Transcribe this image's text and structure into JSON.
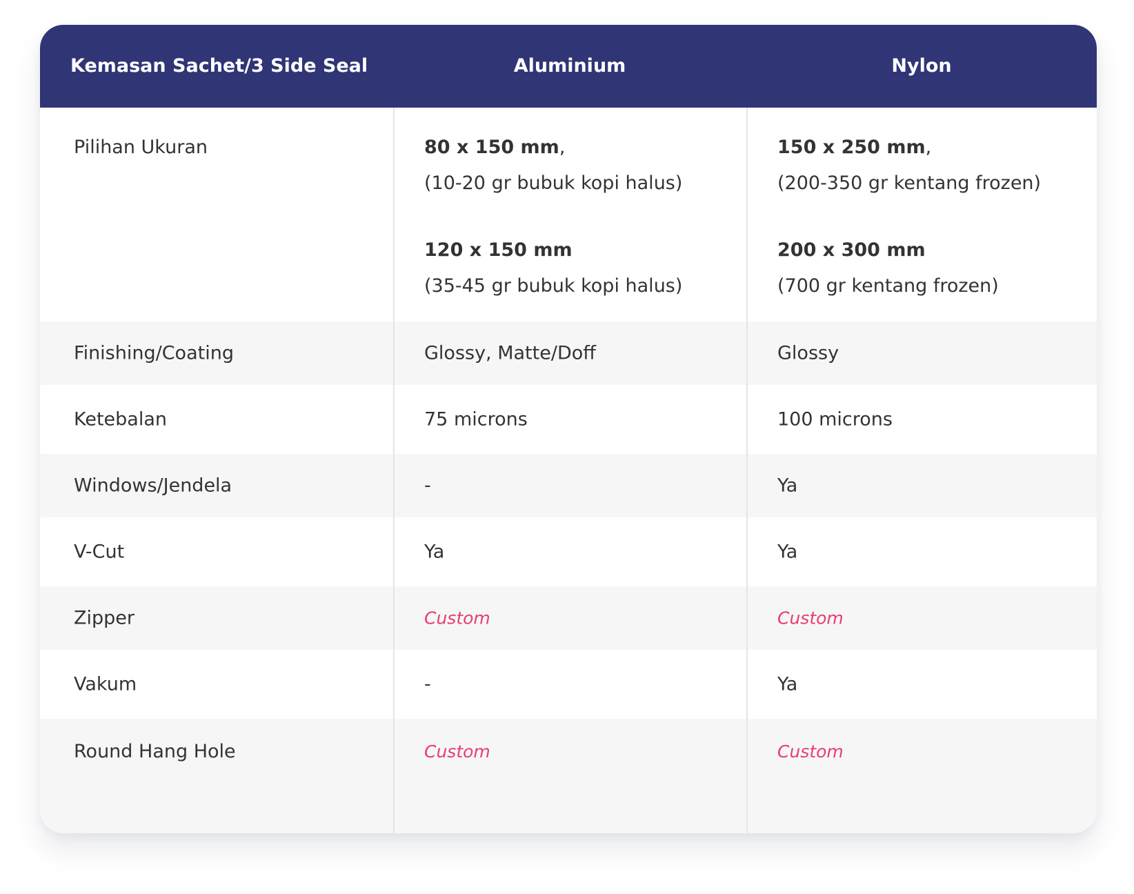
{
  "table": {
    "headers": [
      "Kemasan Sachet/3 Side Seal",
      "Aluminium",
      "Nylon"
    ],
    "sizes": {
      "label": "Pilihan Ukuran",
      "aluminium": [
        {
          "title": "80 x 150 mm",
          "suffix": ",",
          "note": "(10-20 gr bubuk kopi halus)"
        },
        {
          "title": "120 x 150 mm",
          "suffix": "",
          "note": "(35-45 gr bubuk kopi halus)"
        }
      ],
      "nylon": [
        {
          "title": "150 x 250 mm",
          "suffix": ",",
          "note": "(200-350 gr kentang frozen)"
        },
        {
          "title": "200 x 300 mm",
          "suffix": "",
          "note": "(700 gr kentang frozen)"
        }
      ]
    },
    "rows": [
      {
        "label": "Finishing/Coating",
        "aluminium": "Glossy, Matte/Doff",
        "nylon": "Glossy"
      },
      {
        "label": "Ketebalan",
        "aluminium": "75 microns",
        "nylon": "100 microns"
      },
      {
        "label": "Windows/Jendela",
        "aluminium": "-",
        "nylon": "Ya"
      },
      {
        "label": "V-Cut",
        "aluminium": "Ya",
        "nylon": "Ya"
      },
      {
        "label": "Zipper",
        "aluminium": "Custom",
        "nylon": "Custom"
      },
      {
        "label": "Vakum",
        "aluminium": "-",
        "nylon": "Ya"
      },
      {
        "label": "Round Hang Hole",
        "aluminium": "Custom",
        "nylon": "Custom"
      }
    ]
  },
  "colors": {
    "header_bg": "#2f3575",
    "custom_text": "#e83e6c",
    "alt_row_bg": "#f6f6f7"
  }
}
